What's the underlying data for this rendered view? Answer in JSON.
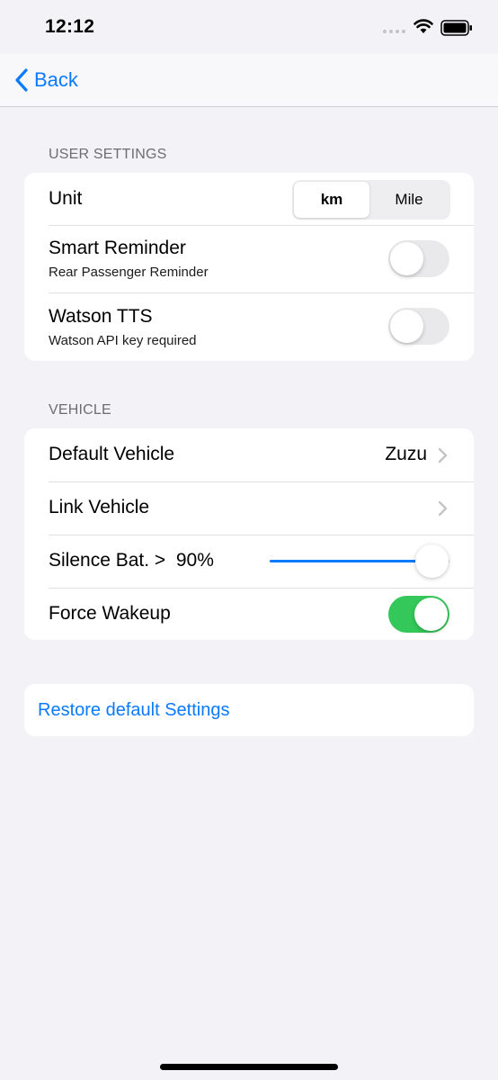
{
  "status_bar": {
    "time": "12:12"
  },
  "nav": {
    "back_label": "Back"
  },
  "user_settings": {
    "header": "USER SETTINGS",
    "unit": {
      "label": "Unit",
      "options": [
        "km",
        "Mile"
      ],
      "selected": "km"
    },
    "smart_reminder": {
      "label": "Smart Reminder",
      "subtitle": "Rear Passenger Reminder",
      "on": false
    },
    "watson_tts": {
      "label": "Watson TTS",
      "subtitle": "Watson API key required",
      "on": false
    }
  },
  "vehicle": {
    "header": "VEHICLE",
    "default_vehicle": {
      "label": "Default Vehicle",
      "value": "Zuzu"
    },
    "link_vehicle": {
      "label": "Link Vehicle"
    },
    "silence_battery": {
      "label": "Silence Bat. >  90%",
      "percent": 90
    },
    "force_wakeup": {
      "label": "Force Wakeup",
      "on": true
    }
  },
  "restore": {
    "label": "Restore default Settings"
  },
  "colors": {
    "accent": "#0a7aff",
    "toggle_on": "#34c759",
    "background": "#f2f2f7"
  },
  "icons": [
    "chevron-left-icon",
    "wifi-icon",
    "battery-icon",
    "chevron-right-icon"
  ]
}
